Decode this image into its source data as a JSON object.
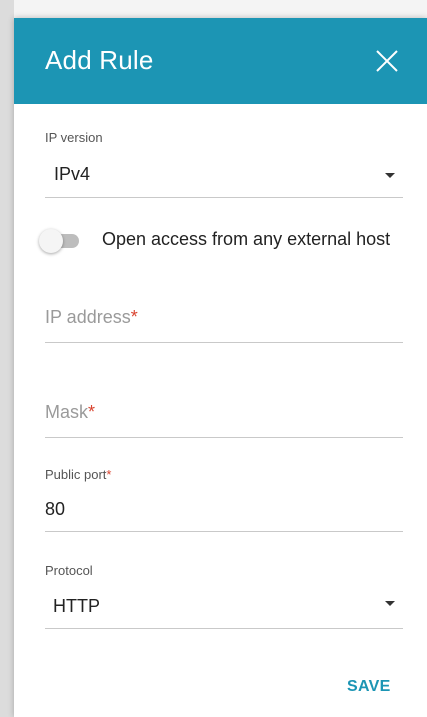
{
  "dialog": {
    "title": "Add Rule",
    "close_icon": "close-icon"
  },
  "ip_version": {
    "label": "IP version",
    "value": "IPv4"
  },
  "toggle": {
    "label": "Open access from any external host",
    "checked": false
  },
  "ip_address": {
    "placeholder": "IP address",
    "required_mark": "*"
  },
  "mask": {
    "placeholder": "Mask",
    "required_mark": "*"
  },
  "public_port": {
    "label": "Public port",
    "required_mark": "*",
    "value": "80"
  },
  "protocol": {
    "label": "Protocol",
    "value": "HTTP"
  },
  "actions": {
    "save_label": "SAVE"
  },
  "colors": {
    "header": "#1c95b4",
    "accent": "#1c95b4",
    "required": "#d9432f"
  }
}
